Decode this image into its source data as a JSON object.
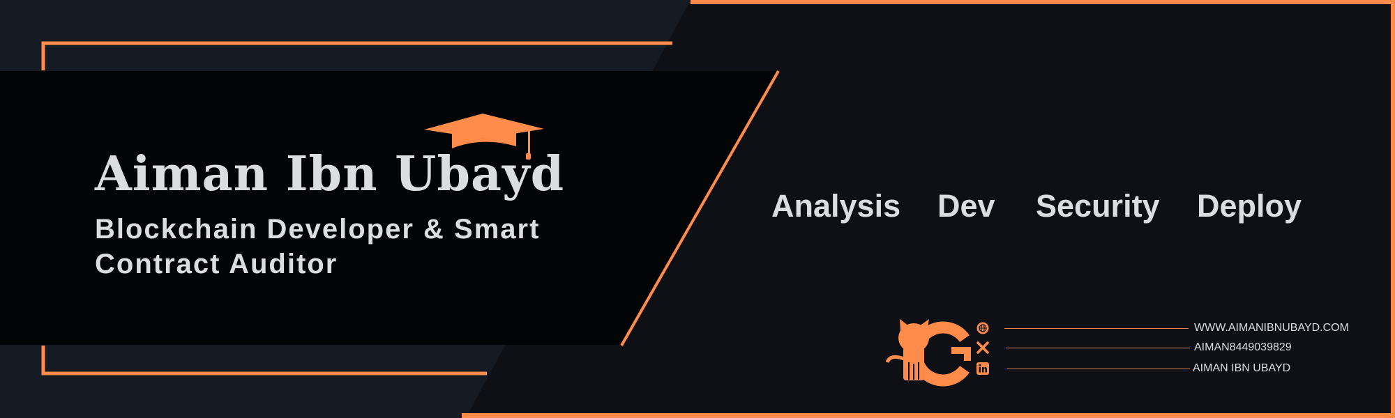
{
  "banner": {
    "name": "Aiman Ibn Ubayd",
    "subtitle": "Blockchain Developer & Smart Contract Auditor",
    "services": [
      "Analysis",
      "Dev",
      "Security",
      "Deploy"
    ],
    "contacts": [
      {
        "icon": "globe-icon",
        "text": "WWW.AIMANIBNUBAYD.COM"
      },
      {
        "icon": "x-icon",
        "text": "AIMAN8449039829"
      },
      {
        "icon": "linkedin-icon",
        "text": "AIMAN IBN UBAYD"
      }
    ]
  },
  "colors": {
    "accent": "#ff8c4a",
    "background": "#0e1016",
    "panel": "#030406",
    "slate": "#151a23",
    "text": "#dcdde0"
  },
  "icons": {
    "graduation": "graduation-cap-icon",
    "logo": "cat-g-logo-icon"
  }
}
